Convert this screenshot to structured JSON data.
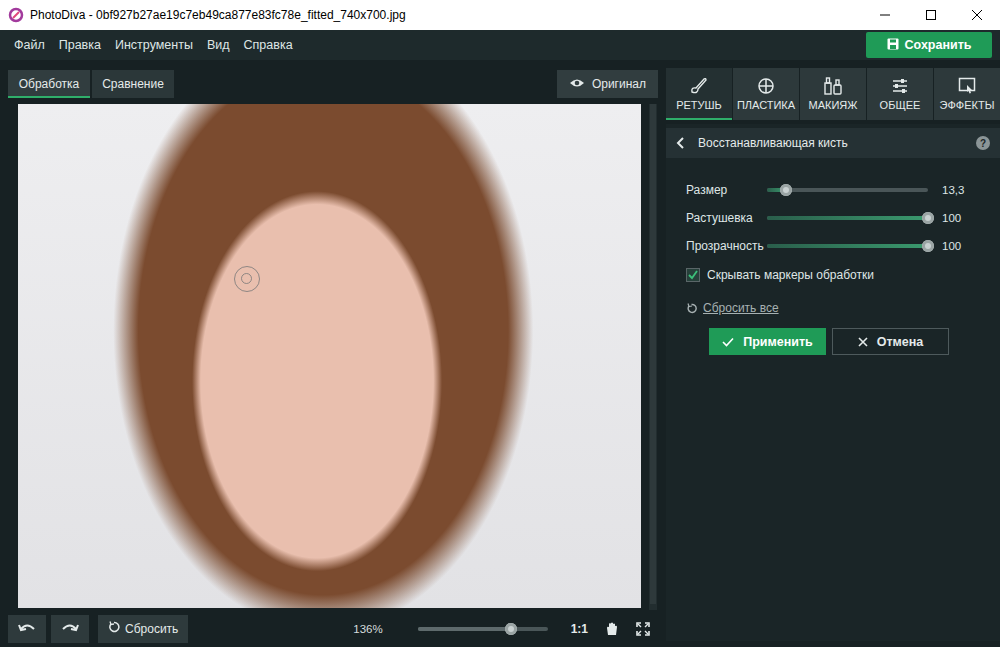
{
  "window": {
    "title": "PhotoDiva - 0bf927b27ae19c7eb49ca877e83fc78e_fitted_740x700.jpg"
  },
  "menu": [
    "Файл",
    "Правка",
    "Инструменты",
    "Вид",
    "Справка"
  ],
  "save_button": "Сохранить",
  "view_tabs": [
    {
      "label": "Обработка",
      "selected": true
    },
    {
      "label": "Сравнение",
      "selected": false
    }
  ],
  "original_button": "Оригинал",
  "bottom_bar": {
    "reset": "Сбросить",
    "zoom": "136%",
    "zoom_level": 0.72,
    "one_to_one": "1:1"
  },
  "tool_tabs": [
    {
      "label": "РЕТУШЬ",
      "selected": true
    },
    {
      "label": "ПЛАСТИКА",
      "selected": false
    },
    {
      "label": "МАКИЯЖ",
      "selected": false
    },
    {
      "label": "ОБЩЕЕ",
      "selected": false
    },
    {
      "label": "ЭФФЕКТЫ",
      "selected": false
    }
  ],
  "tool": {
    "title": "Восстанавливающая кисть",
    "help": "?"
  },
  "sliders": [
    {
      "label": "Размер",
      "value": "13,3",
      "level": 0.12
    },
    {
      "label": "Растушевка",
      "value": "100",
      "level": 1
    },
    {
      "label": "Прозрачность",
      "value": "100",
      "level": 1
    }
  ],
  "checkbox": {
    "label": "Скрывать маркеры обработки",
    "checked": true
  },
  "reset_all": "Сбросить все",
  "buttons": [
    {
      "label": "Применить",
      "kind": "primary"
    },
    {
      "label": "Отмена",
      "kind": "secondary"
    }
  ]
}
